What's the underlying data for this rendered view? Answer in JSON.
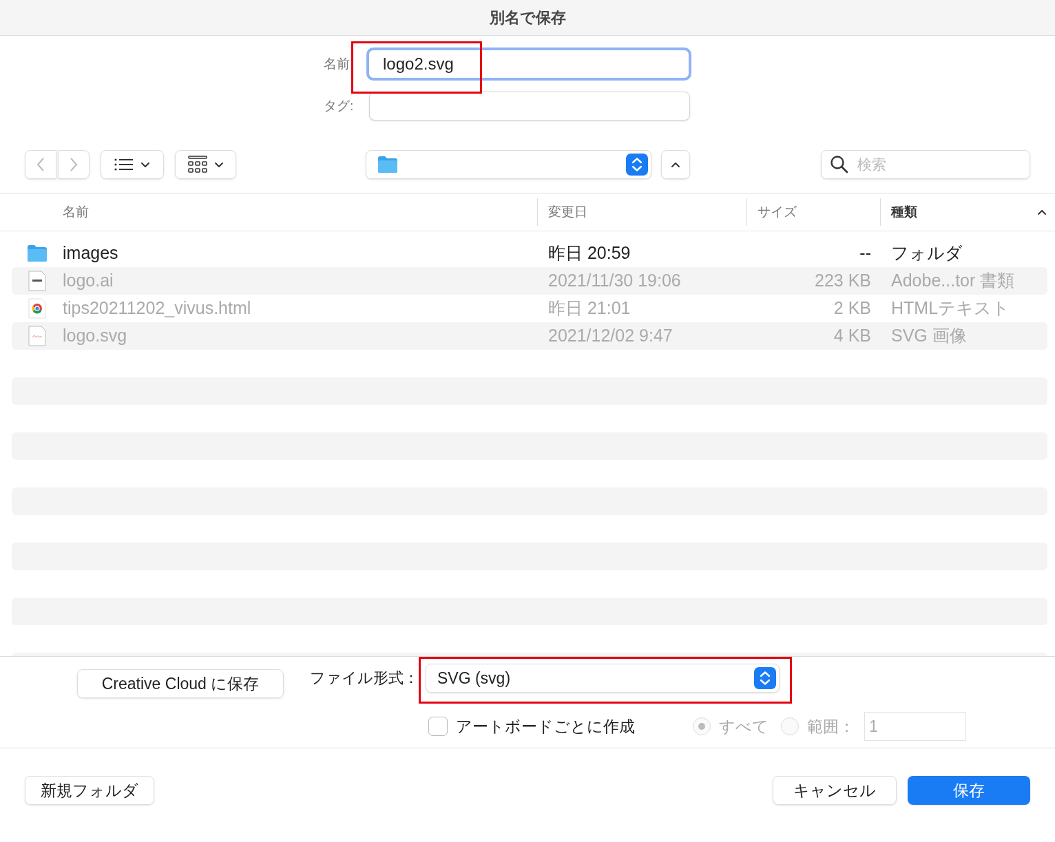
{
  "window": {
    "title": "別名で保存"
  },
  "name_field": {
    "label": "名前",
    "value": "logo2.svg",
    "focused": true,
    "highlighted": true
  },
  "tag_field": {
    "label": "タグ:"
  },
  "search": {
    "placeholder": "検索"
  },
  "columns": [
    {
      "label": "名前",
      "sorted": false
    },
    {
      "label": "変更日",
      "sorted": false
    },
    {
      "label": "サイズ",
      "sorted": false
    },
    {
      "label": "種類",
      "sorted": true
    }
  ],
  "files": [
    {
      "kind": "folder",
      "name": "images",
      "date": "昨日 20:59",
      "size": "--",
      "type": "フォルダ",
      "disabled": false
    },
    {
      "kind": "ai",
      "name": "logo.ai",
      "date": "2021/11/30 19:06",
      "size": "223 KB",
      "type": "Adobe...tor 書類",
      "disabled": true
    },
    {
      "kind": "html",
      "name": "tips20211202_vivus.html",
      "date": "昨日 21:01",
      "size": "2 KB",
      "type": "HTMLテキスト",
      "disabled": true
    },
    {
      "kind": "svg",
      "name": "logo.svg",
      "date": "2021/12/02 9:47",
      "size": "4 KB",
      "type": "SVG 画像",
      "disabled": true
    }
  ],
  "creative_cloud_button": "Creative Cloud に保存",
  "format": {
    "label": "ファイル形式：",
    "value": "SVG (svg)",
    "highlighted": true
  },
  "artboard_checkbox": {
    "label": "アートボードごとに作成",
    "checked": false
  },
  "range_options": [
    {
      "label": "すべて",
      "selected": true,
      "disabled": true
    },
    {
      "label": "範囲：",
      "selected": false,
      "disabled": true
    }
  ],
  "range_field": {
    "value": "1",
    "disabled": true
  },
  "buttons": {
    "new_folder": "新規フォルダ",
    "cancel": "キャンセル",
    "save": "保存"
  }
}
